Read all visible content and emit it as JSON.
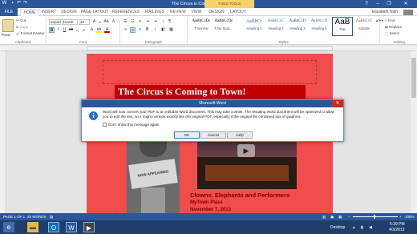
{
  "window": {
    "title": "The Circus is Coming to Town! - Word",
    "help": "?",
    "user": "Elizabeth Nish"
  },
  "table_tools": "TABLE TOOLS",
  "tabs": [
    "FILE",
    "HOME",
    "INSERT",
    "DESIGN",
    "PAGE LAYOUT",
    "REFERENCES",
    "MAILINGS",
    "REVIEW",
    "VIEW",
    "DESIGN",
    "LAYOUT"
  ],
  "clipboard": {
    "cut": "Cut",
    "copy": "Copy",
    "format_painter": "Format Painter",
    "paste": "Paste",
    "label": "Clipboard"
  },
  "font": {
    "name": "Impact (Headi",
    "size": "28",
    "label": "Font"
  },
  "paragraph": {
    "label": "Paragraph"
  },
  "styles": {
    "label": "Styles",
    "items": [
      {
        "sample": "AaBbCcDc",
        "name": "¶ Normal"
      },
      {
        "sample": "AaBbCcDc",
        "name": "¶ No Spac..."
      },
      {
        "sample": "AaBbCc",
        "name": "Heading 1"
      },
      {
        "sample": "AaBbCcC",
        "name": "Heading 2"
      },
      {
        "sample": "AaBbCcD",
        "name": "Heading 3"
      },
      {
        "sample": "AaBbCcD",
        "name": "Heading 4"
      },
      {
        "sample": "AaB",
        "name": "Title"
      },
      {
        "sample": "AaBbCcC",
        "name": "Subtitle"
      }
    ]
  },
  "editing": {
    "find": "Find",
    "replace": "Replace",
    "select": "Select",
    "label": "Editing"
  },
  "document": {
    "headline": "The Circus is Coming to Town!",
    "line1": "Clowns, Elephants and Performers",
    "line2": "MyTown Plaza",
    "line3": "November 7, 2013",
    "sign": "NOW APPEARING"
  },
  "dialog": {
    "title": "Microsoft Word",
    "close": "✕",
    "message": "Word will now convert your PDF to an editable Word document. This may take a while. The resulting Word document will be optimized to allow you to edit the text, so it might not look exactly like the original PDF, especially if the original file contained lots of graphics.",
    "checkbox_label": "Don't show this message again",
    "ok": "OK",
    "cancel": "Cancel",
    "help": "Help"
  },
  "status": {
    "page": "PAGE 1 OF 1",
    "words": "20 WORDS",
    "zoom": "100%"
  },
  "taskbar": {
    "desktop": "Desktop",
    "time": "5:39 PM",
    "date": "4/3/2013"
  },
  "colors": {
    "accent": "#2b579a",
    "page": "#f24d4d",
    "heading_bg": "#c00000"
  }
}
